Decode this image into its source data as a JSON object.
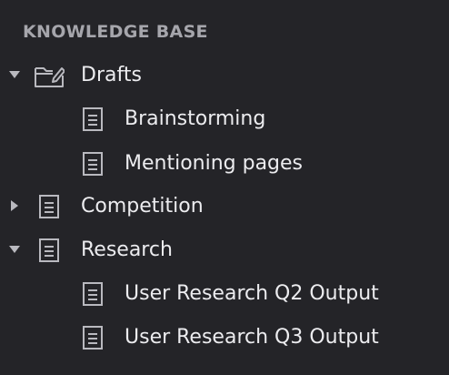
{
  "section": {
    "title": "KNOWLEDGE BASE"
  },
  "tree": {
    "items": [
      {
        "label": "Drafts",
        "icon": "folder-edit-icon",
        "expanded": true,
        "has_children": true,
        "level": 0
      },
      {
        "label": "Brainstorming",
        "icon": "document-icon",
        "expanded": false,
        "has_children": false,
        "level": 1
      },
      {
        "label": "Mentioning pages",
        "icon": "document-icon",
        "expanded": false,
        "has_children": false,
        "level": 1
      },
      {
        "label": "Competition",
        "icon": "document-icon",
        "expanded": false,
        "has_children": true,
        "level": 0
      },
      {
        "label": "Research",
        "icon": "document-icon",
        "expanded": true,
        "has_children": true,
        "level": 0
      },
      {
        "label": "User Research Q2 Output",
        "icon": "document-icon",
        "expanded": false,
        "has_children": false,
        "level": 1
      },
      {
        "label": "User Research Q3 Output",
        "icon": "document-icon",
        "expanded": false,
        "has_children": false,
        "level": 1
      }
    ]
  },
  "colors": {
    "background": "#242428",
    "text": "#ececef",
    "section_title": "#a6a6ac",
    "icon": "#b9b9bf"
  }
}
